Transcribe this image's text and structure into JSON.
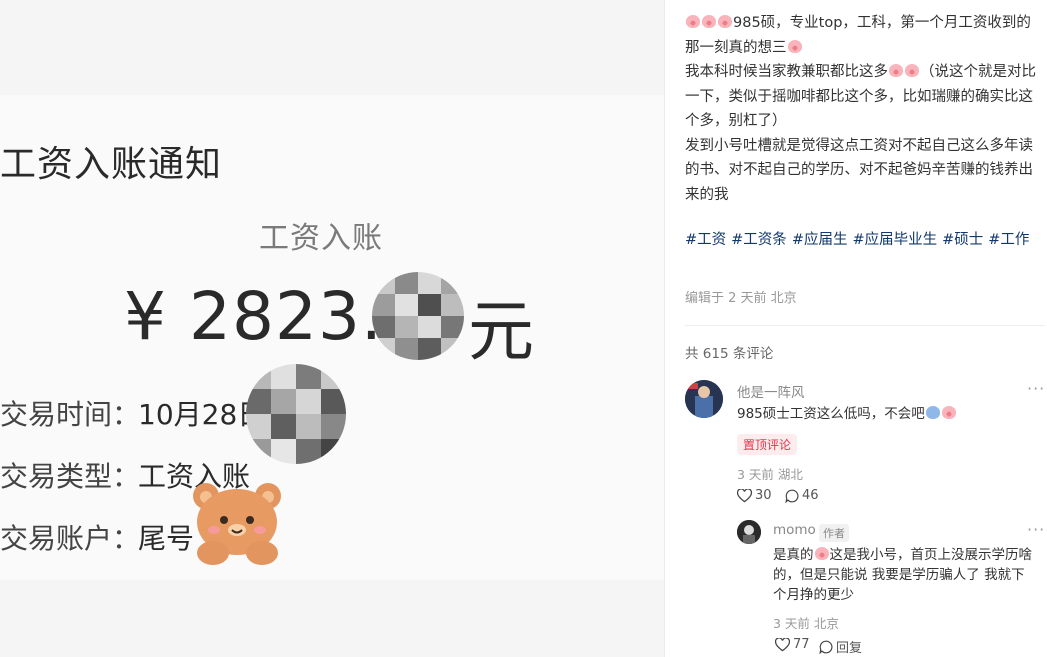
{
  "receipt": {
    "title": "工资入账通知",
    "subtitle": "工资入账",
    "amount": "¥ 2823.",
    "unit": "元",
    "rows": [
      {
        "label": "交易时间：",
        "value": "10月28日"
      },
      {
        "label": "交易类型：",
        "value": "工资入账"
      },
      {
        "label": "交易账户：",
        "value": "尾号"
      }
    ]
  },
  "post": {
    "paragraphs": [
      "985硕，专业top，工科，第一个月工资收到的那一刻真的想三",
      "我本科时候当家教兼职都比这多",
      "（说这个就是对比一下，类似于摇咖啡都比这个多，比如瑞赚的确实比这个多，别杠了）",
      "发到小号吐槽就是觉得这点工资对不起自己这么多年读的书、对不起自己的学历、对不起爸妈辛苦赚的钱养出来的我"
    ],
    "tags": [
      "#工资",
      "#工资条",
      "#应届生",
      "#应届毕业生",
      "#硕士",
      "#工作"
    ],
    "edited": "编辑于 2 天前 北京"
  },
  "comments": {
    "count_label": "共 615 条评论",
    "items": [
      {
        "user": "他是一阵风",
        "text": "985硕士工资这么低吗，不会吧",
        "badge": "置顶评论",
        "meta": "3 天前 湖北",
        "likes": "30",
        "replies": "46"
      }
    ],
    "reply": {
      "user": "momo",
      "author_tag": "作者",
      "text_lines": [
        "是真的",
        "这是我小号，首页上没展示学历啥",
        "的，但是只能说 我要是学历骗人了 我就下",
        "个月挣的更少"
      ],
      "meta": "3 天前 北京",
      "likes": "77",
      "reply_label": "回复"
    }
  },
  "colors": {
    "tag": "#13386c",
    "badge_text": "#e8334a",
    "badge_bg": "#fdecee"
  }
}
